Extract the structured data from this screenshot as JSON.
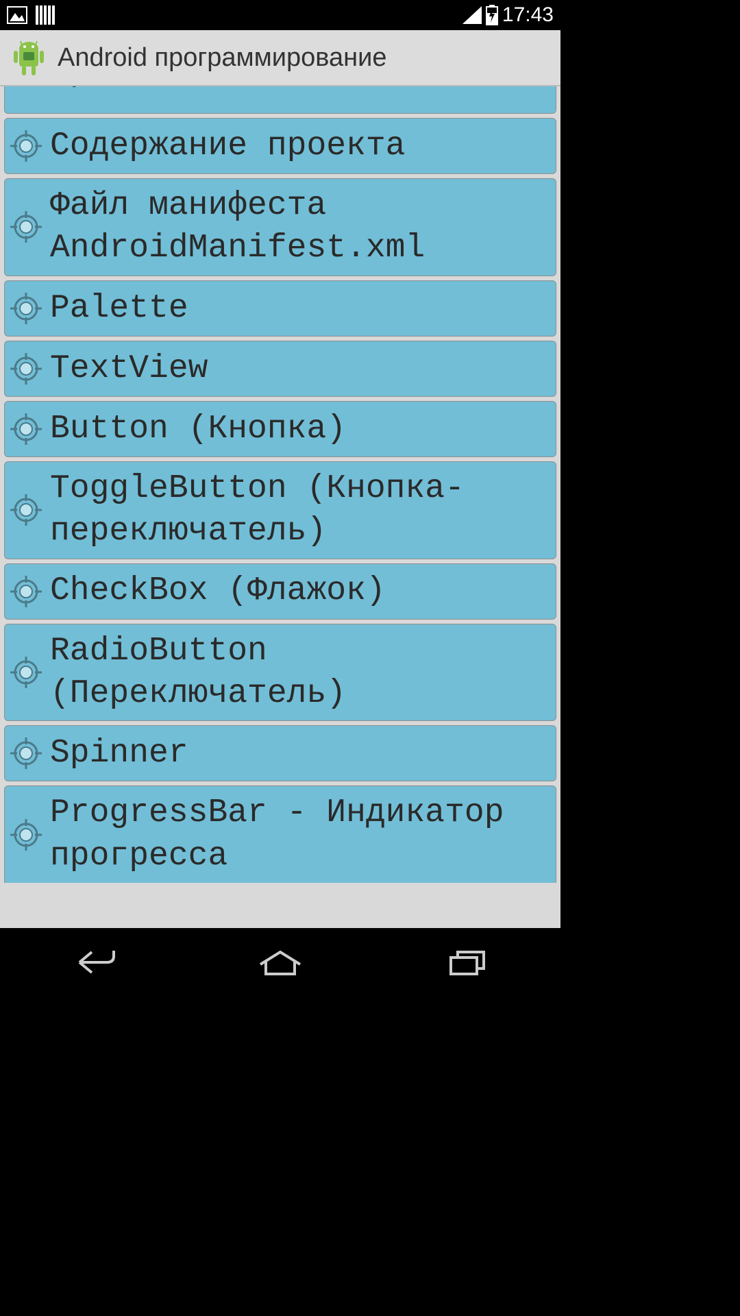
{
  "statusBar": {
    "time": "17:43"
  },
  "appBar": {
    "title": "Android программирование"
  },
  "list": {
    "items": [
      {
        "label": "проекта",
        "cutoff": "top"
      },
      {
        "label": "Содержание проекта"
      },
      {
        "label": "Файл манифеста AndroidManifest.xml"
      },
      {
        "label": "Palette"
      },
      {
        "label": "TextView"
      },
      {
        "label": "Button (Кнопка)"
      },
      {
        "label": "ToggleButton (Кнопка-переключатель)"
      },
      {
        "label": "CheckBox (Флажок)"
      },
      {
        "label": "RadioButton (Переключатель)"
      },
      {
        "label": "Spinner"
      },
      {
        "label": "ProgressBar - Индикатор прогресса",
        "cutoff": "bottom"
      }
    ]
  }
}
